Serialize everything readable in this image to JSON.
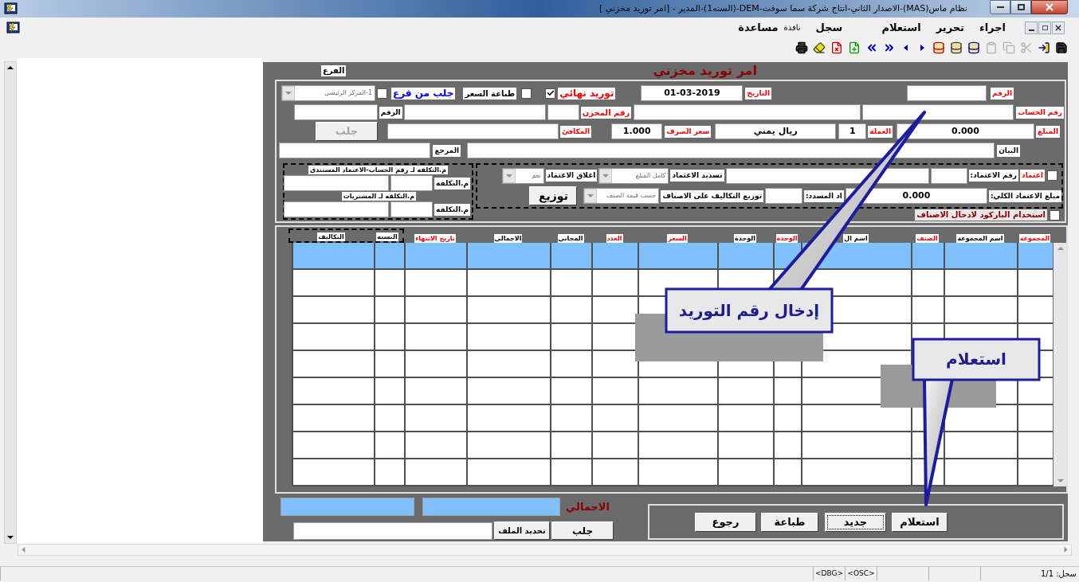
{
  "window": {
    "title": "نظام ماس(MAS)-الاصدار الثاني-انتاج شركة سما سوفت-DEM-(السنه1)-المدير - [امر توريد مخزني ]"
  },
  "menu": [
    {
      "label": "اجراء"
    },
    {
      "label": "تحرير"
    },
    {
      "label": "استعلام"
    },
    {
      "label": "سجل"
    },
    {
      "label": "نافذة"
    },
    {
      "label": "مساعدة"
    }
  ],
  "form": {
    "title": "امر توريد مخزني",
    "branch_label": "الفرع",
    "lines": [
      {
        "items": [
          {
            "kind": "label",
            "text": "الرقم",
            "color": "#ff0000"
          },
          {
            "kind": "field"
          },
          {
            "kind": "label",
            "text": "التاريخ",
            "color": "#ff0000"
          },
          {
            "kind": "field",
            "value": "01-03-2019"
          },
          {
            "kind": "label",
            "text": "توريد نهائي",
            "color": "#ff0000"
          },
          {
            "kind": "checkbox",
            "checked": true
          },
          {
            "kind": "checkbox",
            "checked": false
          },
          {
            "kind": "label",
            "text": "طباعة السعر",
            "color": "#000000"
          },
          {
            "kind": "label",
            "text": "جلب من فرع",
            "color": "#0000ff"
          },
          {
            "kind": "checkbox",
            "checked": false
          },
          {
            "kind": "combo",
            "value": "1-المركز الرئيسي"
          }
        ]
      },
      {
        "items": [
          {
            "kind": "label",
            "text": "رقم الحساب",
            "color": "#ff0000"
          },
          {
            "kind": "field"
          },
          {
            "kind": "field"
          },
          {
            "kind": "label",
            "text": "رقم المخزن",
            "color": "#ff0000"
          },
          {
            "kind": "field"
          },
          {
            "kind": "field"
          },
          {
            "kind": "label",
            "text": "الرقم",
            "color": "#000000"
          },
          {
            "kind": "field"
          }
        ]
      },
      {
        "items": [
          {
            "kind": "label",
            "text": "المبلغ",
            "color": "#ff0000"
          },
          {
            "kind": "field",
            "value": "0.000"
          },
          {
            "kind": "label",
            "text": "العملة",
            "color": "#ff0000"
          },
          {
            "kind": "field",
            "value": "1"
          },
          {
            "kind": "field",
            "value": "ريال يمني"
          },
          {
            "kind": "label",
            "text": "سعر الصرف",
            "color": "#ff0000"
          },
          {
            "kind": "field",
            "value": "1.000"
          },
          {
            "kind": "label",
            "text": "المكافئ",
            "color": "#ff0000"
          },
          {
            "kind": "field"
          },
          {
            "kind": "button",
            "label": "جلب",
            "disabled": true
          }
        ]
      },
      {
        "items": [
          {
            "kind": "label",
            "text": "البيان",
            "color": "#000000"
          },
          {
            "kind": "field"
          },
          {
            "kind": "label",
            "text": "المرجع",
            "color": "#000000"
          },
          {
            "kind": "field"
          }
        ]
      }
    ],
    "approval": [
      {
        "items": [
          {
            "kind": "checkbox",
            "checked": false
          },
          {
            "kind": "label",
            "text": "اعتماد",
            "color": "#ff0000"
          },
          {
            "kind": "label",
            "text": "رقم الاعتماد:",
            "color": "#000000"
          },
          {
            "kind": "field"
          },
          {
            "kind": "field"
          },
          {
            "kind": "label",
            "text": "تسديد الاعتماد",
            "color": "#000000"
          },
          {
            "kind": "combo",
            "value": "كامل المبلغ"
          },
          {
            "kind": "label",
            "text": "اغلاق الاعتماد",
            "color": "#000000"
          },
          {
            "kind": "combo",
            "value": "نعم"
          }
        ]
      },
      {
        "items": [
          {
            "kind": "label",
            "text": "مبلغ الاعتماد الكلي:",
            "color": "#000000"
          },
          {
            "kind": "field",
            "value": "0.000"
          },
          {
            "kind": "label",
            "text": "اد المسدد:",
            "color": "#000000"
          },
          {
            "kind": "field"
          },
          {
            "kind": "label",
            "text": "توزيع التكاليف على الاصناف",
            "color": "#000000"
          },
          {
            "kind": "combo",
            "value": "حسب قيمة الصنف"
          },
          {
            "kind": "button",
            "label": "توزيع",
            "disabled": false
          }
        ]
      }
    ],
    "cost_centers": [
      {
        "items": [
          {
            "kind": "caption",
            "text": "م.التكلفه لـ رقم الحساب-الاعتماد المستندى"
          }
        ]
      },
      {
        "items": [
          {
            "kind": "label",
            "text": "م.التكلفه",
            "color": "#000000"
          },
          {
            "kind": "field"
          },
          {
            "kind": "field"
          }
        ]
      },
      {
        "items": [
          {
            "kind": "caption",
            "text": "م.التكلفه لـ المشتريات"
          }
        ]
      },
      {
        "items": [
          {
            "kind": "label",
            "text": "م.التكلفه",
            "color": "#000000"
          },
          {
            "kind": "field"
          },
          {
            "kind": "field"
          }
        ]
      }
    ],
    "barcode": {
      "label": "استخدام الباركود لادخال الاصناف",
      "checked": false
    }
  },
  "grid": {
    "columns": [
      {
        "label": "المجموعة",
        "color": "#ff0000"
      },
      {
        "label": "اسم المجموعة",
        "color": "#000000"
      },
      {
        "label": "الصنف",
        "color": "#ff0000"
      },
      {
        "label": "اسم ال",
        "color": "#000000"
      },
      {
        "label": "الوحدة",
        "color": "#ff0000"
      },
      {
        "label": "الوحدة",
        "color": "#000000"
      },
      {
        "label": "السعر",
        "color": "#ff0000"
      },
      {
        "label": "العدد",
        "color": "#ff0000"
      },
      {
        "label": "المجاني",
        "color": "#000000"
      },
      {
        "label": "الاجمالي",
        "color": "#000000"
      },
      {
        "label": "تاريخ الانتهاء",
        "color": "#ff0000"
      },
      {
        "label": "النسبه",
        "color": "#000000"
      },
      {
        "label": "التكاليف",
        "color": "#000000"
      }
    ],
    "rows": [
      {
        "selected": true
      },
      {
        "selected": false
      },
      {
        "selected": false
      },
      {
        "selected": false
      },
      {
        "selected": false
      },
      {
        "selected": false
      },
      {
        "selected": false
      },
      {
        "selected": false
      },
      {
        "selected": false
      }
    ]
  },
  "totals": {
    "label": "الاجمالي"
  },
  "file": {
    "fetch_button": "جلب",
    "select_button": "تحديد الملف"
  },
  "actions": [
    {
      "label": "استعلام",
      "focused": false
    },
    {
      "label": "جديد",
      "focused": true
    },
    {
      "label": "طباعة",
      "focused": false
    },
    {
      "label": "رجوع",
      "focused": false
    }
  ],
  "callouts": [
    {
      "text": "إدخال رقم التوريد"
    },
    {
      "text": "استعلام"
    }
  ],
  "status_bar": {
    "record": "سجل: 1/1",
    "flags": [
      "<OSC>",
      "<DBG>"
    ]
  }
}
